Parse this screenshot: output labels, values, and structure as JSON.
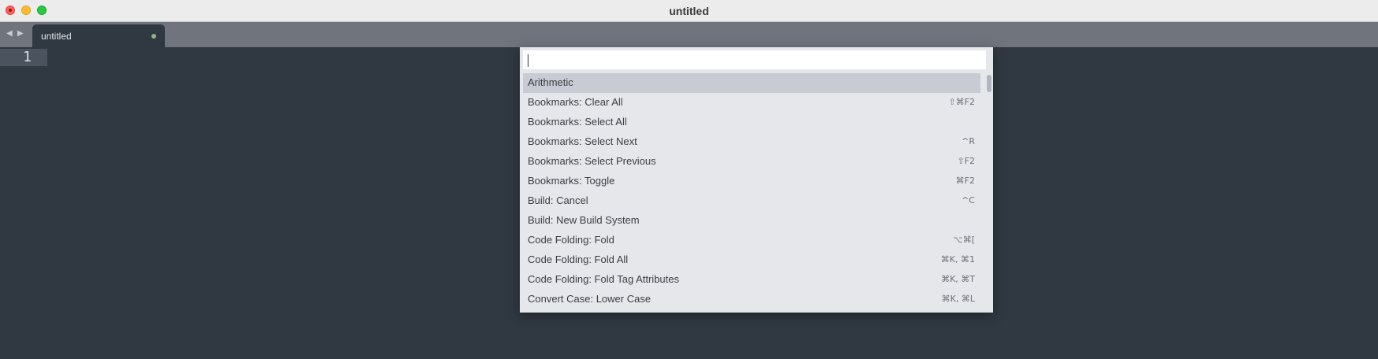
{
  "window": {
    "title": "untitled"
  },
  "tabbar": {
    "back_icon": "triangle-left",
    "forward_icon": "triangle-right",
    "tabs": [
      {
        "label": "untitled",
        "modified": true
      }
    ]
  },
  "editor": {
    "line_numbers": [
      "1"
    ]
  },
  "command_palette": {
    "query": "",
    "selected_index": 0,
    "items": [
      {
        "label": "Arithmetic",
        "shortcut": ""
      },
      {
        "label": "Bookmarks: Clear All",
        "shortcut": "⇧⌘F2"
      },
      {
        "label": "Bookmarks: Select All",
        "shortcut": ""
      },
      {
        "label": "Bookmarks: Select Next",
        "shortcut": "^R"
      },
      {
        "label": "Bookmarks: Select Previous",
        "shortcut": "⇧F2"
      },
      {
        "label": "Bookmarks: Toggle",
        "shortcut": "⌘F2"
      },
      {
        "label": "Build: Cancel",
        "shortcut": "^C"
      },
      {
        "label": "Build: New Build System",
        "shortcut": ""
      },
      {
        "label": "Code Folding: Fold",
        "shortcut": "⌥⌘["
      },
      {
        "label": "Code Folding: Fold All",
        "shortcut": "⌘K, ⌘1"
      },
      {
        "label": "Code Folding: Fold Tag Attributes",
        "shortcut": "⌘K, ⌘T"
      },
      {
        "label": "Convert Case: Lower Case",
        "shortcut": "⌘K, ⌘L"
      }
    ]
  },
  "colors": {
    "editor_bg": "#303841",
    "tabbar_bg": "#70757d",
    "palette_bg": "#e5e7eb",
    "selected_item_bg": "#c8cbd1",
    "modified_dot": "#8fb48a"
  }
}
